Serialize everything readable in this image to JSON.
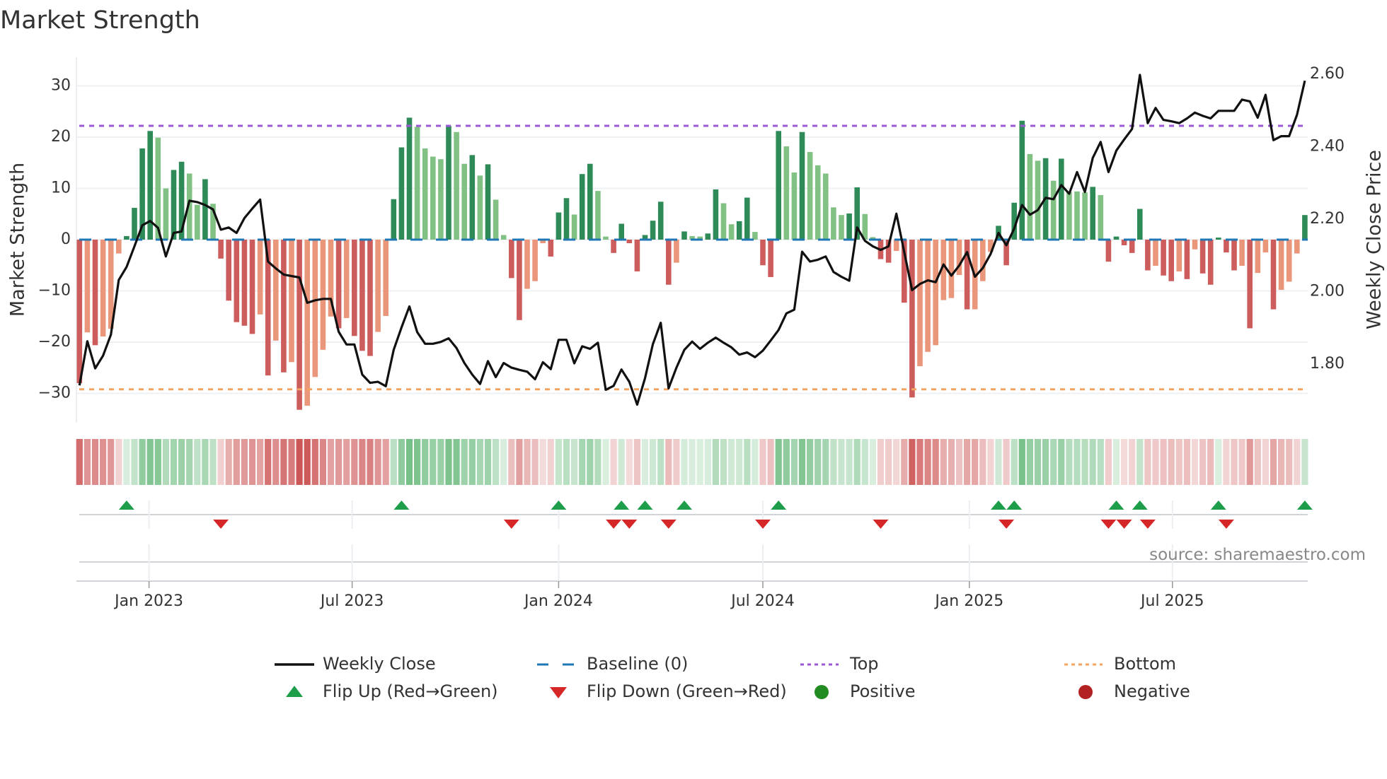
{
  "chart_data": {
    "type": "bar",
    "title": "Market Strength",
    "x": {
      "start": "2022-10-31",
      "frequency": "weekly",
      "count": 157,
      "ticks": [
        {
          "date": "2023-01-01",
          "label": "Jan 2023"
        },
        {
          "date": "2023-07-01",
          "label": "Jul 2023"
        },
        {
          "date": "2024-01-01",
          "label": "Jan 2024"
        },
        {
          "date": "2024-07-01",
          "label": "Jul 2024"
        },
        {
          "date": "2025-01-01",
          "label": "Jan 2025"
        },
        {
          "date": "2025-07-01",
          "label": "Jul 2025"
        }
      ]
    },
    "y_left": {
      "label": "Market Strength",
      "range": [
        -35.7,
        35.5
      ],
      "ticks": [
        -30,
        -20,
        -10,
        0,
        10,
        20,
        30
      ],
      "tick_labels": [
        "−30",
        "−20",
        "−10",
        "0",
        "10",
        "20",
        "30"
      ],
      "grid": true
    },
    "y_right": {
      "label": "Weekly Close Price",
      "range": [
        1.639,
        2.646
      ],
      "ticks": [
        1.8,
        2.0,
        2.2,
        2.4,
        2.6
      ],
      "tick_labels": [
        "1.80",
        "2.00",
        "2.20",
        "2.40",
        "2.60"
      ]
    },
    "series": [
      {
        "name": "Market Strength",
        "kind": "bar",
        "values": [
          -28,
          -18.1,
          -20.6,
          -18.9,
          -17.4,
          -2.7,
          0.7,
          6.2,
          17.8,
          21.2,
          19.9,
          10,
          13.6,
          15.2,
          12.9,
          6.8,
          11.8,
          7,
          -3.7,
          -11.9,
          -16.1,
          -16.8,
          -18.4,
          -14.6,
          -26.5,
          -19.7,
          -25.9,
          -23.9,
          -33.2,
          -32.4,
          -26.8,
          -21.5,
          -15,
          -17.3,
          -15.3,
          -18.8,
          -21.7,
          -22.7,
          -18,
          -14.9,
          7.9,
          18,
          23.8,
          22,
          17.8,
          16.2,
          15.7,
          22.2,
          21,
          14.8,
          16.5,
          12.5,
          14.7,
          7.8,
          0.9,
          -7.5,
          -15.7,
          -9.6,
          -8.1,
          -0.7,
          -3.3,
          5.3,
          8.1,
          4.9,
          12.8,
          14.8,
          9.5,
          0.6,
          -2.6,
          3.1,
          -0.7,
          -6.2,
          0.9,
          3.7,
          7.4,
          -8.8,
          -4.5,
          1.6,
          0.7,
          0.6,
          1.2,
          9.8,
          7.1,
          3,
          3.6,
          8.2,
          1.5,
          -5,
          -7.3,
          21.2,
          18.2,
          13.1,
          21,
          17.1,
          14.5,
          12.9,
          6.3,
          4.8,
          5.1,
          10.2,
          5,
          0.5,
          -3.8,
          -4.5,
          -2.2,
          -12.3,
          -30.8,
          -24.7,
          -21.9,
          -20.6,
          -11.8,
          -11.4,
          -6.9,
          -13.6,
          -13.6,
          -8.1,
          -2.4,
          2.7,
          -5,
          7.2,
          23.2,
          16.7,
          15.4,
          15.9,
          11.5,
          15.8,
          9.3,
          9.4,
          9.2,
          10.3,
          8.7,
          -4.3,
          0.6,
          -1.1,
          -2.6,
          6,
          -6,
          -5.1,
          -7,
          -8.1,
          -6.2,
          -7.7,
          -1.9,
          -6.6,
          -8.8,
          0.4,
          -2.5,
          -6,
          -5.1,
          -17.3,
          -6.5,
          -2.5,
          -13.6,
          -9.8,
          -8.2,
          -2.7,
          4.8
        ],
        "shade": "DLDLLLDDDDLLDDLLDLDDDDDLDLDLDLLLLDLDDDLLDDDLLLLDLLDLDLLDDLLLDDDLDDLLDDDDDDDDLDLLDDLLDDLDDDLLDLLLLLDDLLDDLDDLLLLLLDLLLDDDDLLDLDLLLDLDDDDDDLDDLDLDDDDDLDLLDLLLD"
      },
      {
        "name": "Weekly Close",
        "kind": "line",
        "axis": "right",
        "values": [
          1.741,
          1.863,
          1.788,
          1.823,
          1.881,
          2.032,
          2.068,
          2.125,
          2.183,
          2.195,
          2.176,
          2.097,
          2.162,
          2.166,
          2.251,
          2.247,
          2.239,
          2.227,
          2.171,
          2.177,
          2.162,
          2.203,
          2.229,
          2.254,
          2.083,
          2.064,
          2.047,
          2.043,
          2.039,
          1.969,
          1.976,
          1.98,
          1.98,
          1.889,
          1.854,
          1.854,
          1.771,
          1.748,
          1.751,
          1.739,
          1.839,
          1.901,
          1.959,
          1.888,
          1.856,
          1.856,
          1.861,
          1.871,
          1.844,
          1.803,
          1.771,
          1.745,
          1.808,
          1.764,
          1.803,
          1.79,
          1.784,
          1.779,
          1.758,
          1.805,
          1.786,
          1.867,
          1.867,
          1.802,
          1.849,
          1.842,
          1.859,
          1.729,
          1.74,
          1.785,
          1.751,
          1.688,
          1.761,
          1.855,
          1.914,
          1.733,
          1.79,
          1.839,
          1.862,
          1.842,
          1.859,
          1.873,
          1.859,
          1.846,
          1.826,
          1.832,
          1.819,
          1.837,
          1.865,
          1.894,
          1.94,
          1.95,
          2.11,
          2.083,
          2.088,
          2.097,
          2.054,
          2.041,
          2.03,
          2.177,
          2.14,
          2.125,
          2.115,
          2.125,
          2.215,
          2.109,
          2.004,
          2.021,
          2.031,
          2.026,
          2.075,
          2.044,
          2.072,
          2.109,
          2.041,
          2.065,
          2.104,
          2.162,
          2.128,
          2.174,
          2.239,
          2.212,
          2.225,
          2.259,
          2.255,
          2.294,
          2.27,
          2.33,
          2.275,
          2.369,
          2.413,
          2.33,
          2.389,
          2.42,
          2.449,
          2.598,
          2.465,
          2.507,
          2.474,
          2.47,
          2.465,
          2.478,
          2.494,
          2.485,
          2.478,
          2.499,
          2.499,
          2.499,
          2.53,
          2.525,
          2.48,
          2.543,
          2.418,
          2.429,
          2.429,
          2.488,
          2.582
        ]
      }
    ],
    "reference_lines": {
      "baseline": 0,
      "top": 22.2,
      "bottom": -29.2
    },
    "flips": {
      "up_weeks": [
        7,
        42,
        62,
        70,
        73,
        78,
        90,
        118,
        120,
        133,
        136,
        146,
        157
      ],
      "down_weeks": [
        19,
        56,
        69,
        71,
        76,
        88,
        103,
        119,
        132,
        134,
        137,
        147
      ]
    },
    "legend": {
      "placement": "bottom-center",
      "items": [
        {
          "label": "Weekly Close",
          "symbol": "line"
        },
        {
          "label": "Baseline (0)",
          "symbol": "dash"
        },
        {
          "label": "Top",
          "symbol": "dot"
        },
        {
          "label": "Bottom",
          "symbol": "dot"
        },
        {
          "label": "Flip Up (Red→Green)",
          "symbol": "triangle-up"
        },
        {
          "label": "Flip Down (Green→Red)",
          "symbol": "triangle-down"
        },
        {
          "label": "Positive",
          "symbol": "circle"
        },
        {
          "label": "Negative",
          "symbol": "circle"
        }
      ]
    },
    "source": "source: sharemaestro.com"
  },
  "colors": {
    "bar_pos_dark": "#2e8b57",
    "bar_pos_light": "#82c184",
    "bar_neg_dark": "#cd5c5c",
    "bar_neg_light": "#e9967a",
    "close_line": "#111111",
    "baseline": "#1f77b4",
    "top": "#9b59d6",
    "bottom": "#f4a460",
    "flip_up": "#1e9e4a",
    "flip_down": "#d62728",
    "positive": "#228b22",
    "negative": "#b22222",
    "grid": "#eef0f4"
  }
}
